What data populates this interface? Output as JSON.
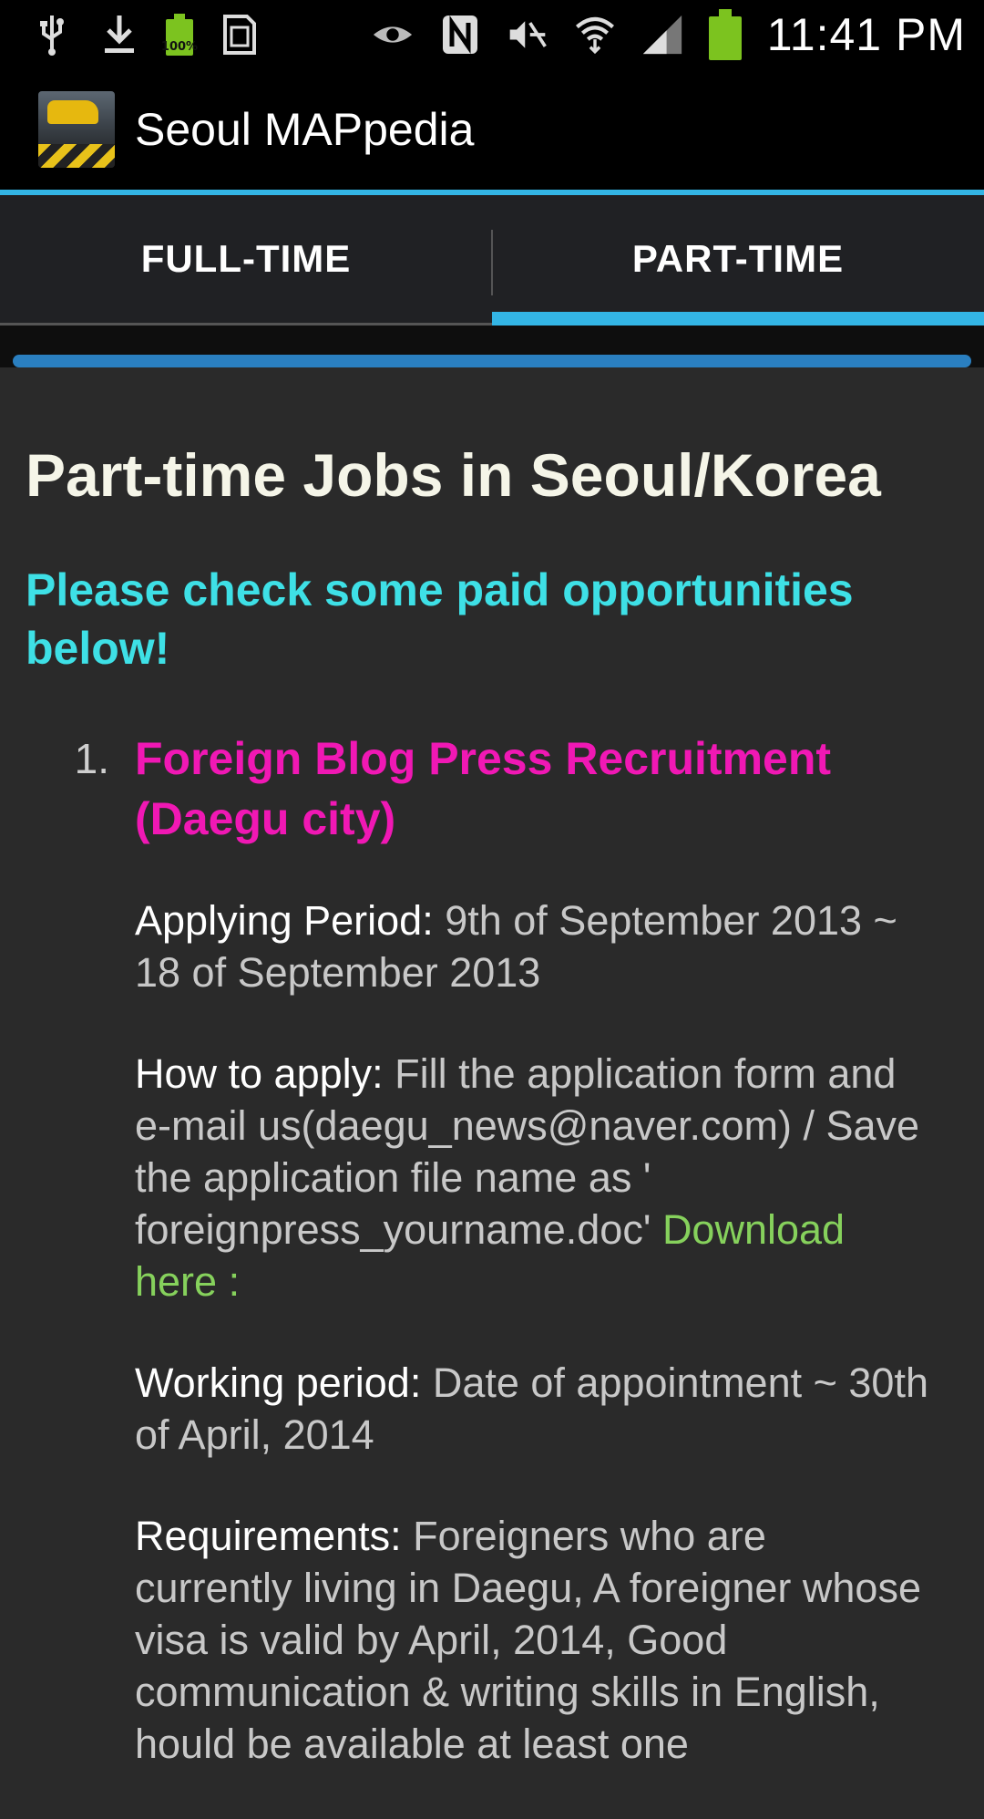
{
  "status_bar": {
    "icons_left": [
      "usb-icon",
      "download-icon",
      "battery-small-icon",
      "sd-card-icon"
    ],
    "battery_small_text": "100%",
    "icons_right": [
      "eye-icon",
      "nfc-icon",
      "mute-icon",
      "wifi-icon",
      "signal-icon",
      "battery-icon"
    ],
    "time": "11:41 PM"
  },
  "action_bar": {
    "title": "Seoul MAPpedia"
  },
  "tabs": [
    {
      "label": "FULL-TIME",
      "active": false
    },
    {
      "label": "PART-TIME",
      "active": true
    }
  ],
  "progress": 1.0,
  "content": {
    "title": "Part-time Jobs in Seoul/Korea",
    "subtitle": "Please check some paid opportunities below!",
    "jobs": [
      {
        "number": "1.",
        "title": "Foreign Blog Press Recruitment (Daegu city)",
        "applying_label": "Applying Period:",
        "applying_value": "9th of September 2013 ~ 18 of September 2013",
        "howto_label": "How to apply:",
        "howto_value": "Fill the application form and e-mail us(daegu_news@naver.com) / Save the application file name as ' foreignpress_yourname.doc'",
        "howto_link": "Download here :",
        "working_label": "Working period:",
        "working_value": "Date of appointment ~ 30th of April, 2014",
        "req_label": "Requirements:",
        "req_value": "Foreigners who are currently living in Daegu, A foreigner whose visa is valid by April, 2014, Good communication & writing skills in English, hould be available at least one"
      }
    ]
  }
}
